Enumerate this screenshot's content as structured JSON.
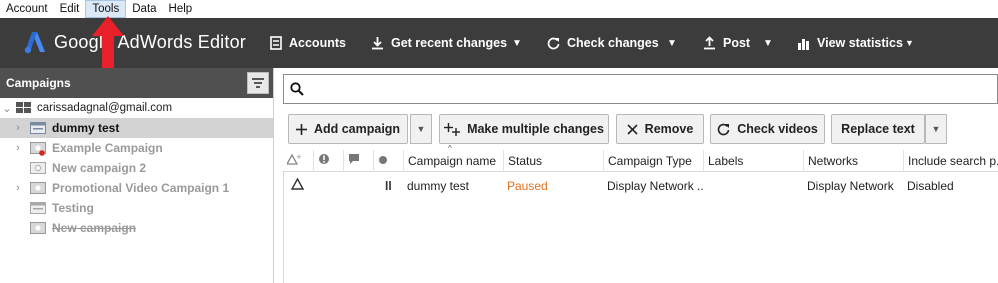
{
  "menu": {
    "items": [
      "Account",
      "Edit",
      "Tools",
      "Data",
      "Help"
    ],
    "active": "Tools"
  },
  "app": {
    "name": "Google AdWords Editor"
  },
  "toolbar": {
    "accounts": "Accounts",
    "get_recent_changes": "Get recent changes",
    "check_changes": "Check changes",
    "post": "Post",
    "view_statistics": "View statistics"
  },
  "left_panel": {
    "title": "Campaigns",
    "account": "carissadagnal@gmail.com",
    "campaigns": [
      {
        "name": "dummy test",
        "state": "selected"
      },
      {
        "name": "Example Campaign",
        "state": "grey"
      },
      {
        "name": "New campaign 2",
        "state": "grey"
      },
      {
        "name": "Promotional Video Campaign 1",
        "state": "grey"
      },
      {
        "name": "Testing",
        "state": "grey"
      },
      {
        "name": "New campaign",
        "state": "deleted"
      }
    ]
  },
  "search": {
    "value": "",
    "placeholder": ""
  },
  "actions": {
    "add_campaign": "Add campaign",
    "make_multiple_changes": "Make multiple changes",
    "remove": "Remove",
    "check_videos": "Check videos",
    "replace_text": "Replace text"
  },
  "grid": {
    "columns": [
      "Campaign name",
      "Status",
      "Campaign Type",
      "Labels",
      "Networks",
      "Include search p..."
    ],
    "rows": [
      {
        "campaign_name": "dummy test",
        "status": "Paused",
        "campaign_type": "Display Network ...",
        "labels": "",
        "networks": "Display Network",
        "include_search": "Disabled"
      }
    ]
  },
  "colors": {
    "toolbar_bg": "#3c3c3c",
    "panel_header_bg": "#505050",
    "status_paused": "#e0711c",
    "annotation_arrow": "#e8202a"
  }
}
